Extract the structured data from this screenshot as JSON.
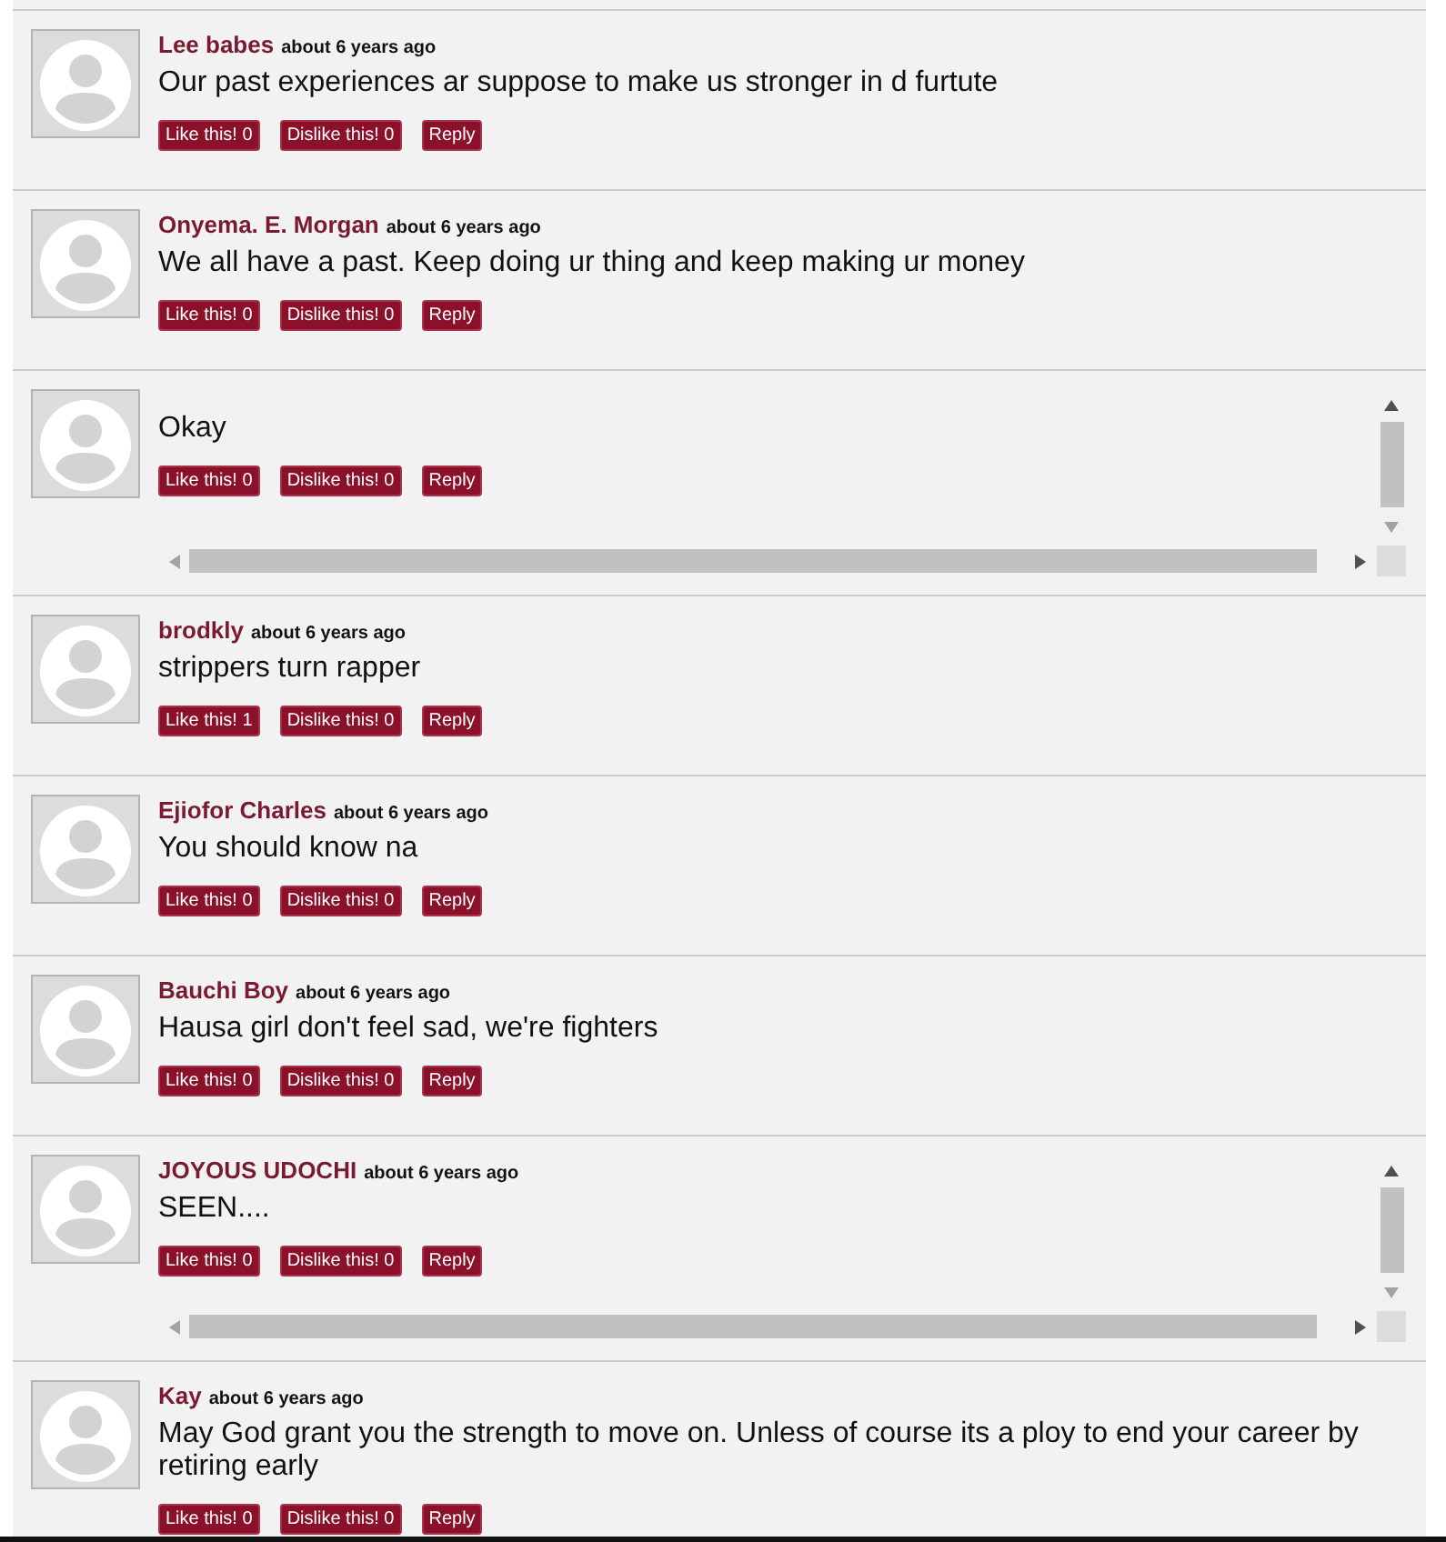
{
  "comments": [
    {
      "kind": "plain",
      "author": "Lee babes",
      "time": "about 6 years ago",
      "text": "Our past experiences ar suppose to make us stronger in d furtute",
      "actions": {
        "like_button": "Like this! 0",
        "dislike_button": "Dislike this! 0",
        "reply_button": "Reply"
      }
    },
    {
      "kind": "plain",
      "author": "Onyema. E. Morgan",
      "time": "about 6 years ago",
      "text": "We all have a past. Keep doing ur thing and keep making ur money",
      "actions": {
        "like_button": "Like this! 0",
        "dislike_button": "Dislike this! 0",
        "reply_button": "Reply"
      }
    },
    {
      "kind": "scrollable",
      "text": "Okay",
      "actions": {
        "like_button": "Like this! 0",
        "dislike_button": "Dislike this! 0",
        "reply_button": "Reply"
      }
    },
    {
      "kind": "plain",
      "author": "brodkly",
      "time": "about 6 years ago",
      "text": "strippers turn rapper",
      "actions": {
        "like_button": "Like this! 1",
        "dislike_button": "Dislike this! 0",
        "reply_button": "Reply"
      }
    },
    {
      "kind": "plain",
      "author": "Ejiofor Charles",
      "time": "about 6 years ago",
      "text": "You should know na",
      "actions": {
        "like_button": "Like this! 0",
        "dislike_button": "Dislike this! 0",
        "reply_button": "Reply"
      }
    },
    {
      "kind": "plain",
      "author": "Bauchi Boy",
      "time": "about 6 years ago",
      "text": "Hausa girl don't feel sad, we're fighters",
      "actions": {
        "like_button": "Like this! 0",
        "dislike_button": "Dislike this! 0",
        "reply_button": "Reply"
      }
    },
    {
      "kind": "scrollable",
      "author": "JOYOUS UDOCHI",
      "time": "about 6 years ago",
      "text": "SEEN....",
      "actions": {
        "like_button": "Like this! 0",
        "dislike_button": "Dislike this! 0",
        "reply_button": "Reply"
      }
    },
    {
      "kind": "plain",
      "author": "Kay",
      "time": "about 6 years ago",
      "text": "May God grant you the strength to move on. Unless of course its a ploy to end your career by retiring early",
      "actions": {
        "like_button": "Like this! 0",
        "dislike_button": "Dislike this! 0",
        "reply_button": "Reply"
      }
    }
  ]
}
